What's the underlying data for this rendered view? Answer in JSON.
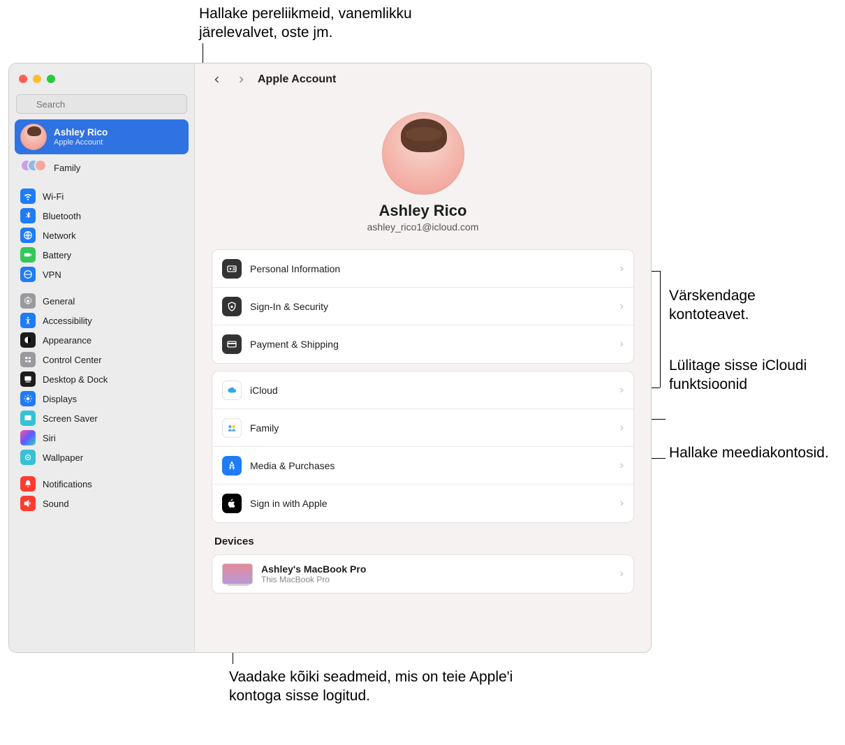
{
  "callouts": {
    "top": "Hallake pereliikmeid, vanemlikku järelevalvet, oste jm.",
    "right1": "Värskendage kontoteavet.",
    "right2": "Lülitage sisse iCloudi funktsioonid",
    "right3": "Hallake meediakontosid.",
    "bottom": "Vaadake kõiki seadmeid, mis on teie Apple'i kontoga sisse logitud."
  },
  "search": {
    "placeholder": "Search"
  },
  "account": {
    "name": "Ashley Rico",
    "role": "Apple Account"
  },
  "family": {
    "label": "Family"
  },
  "sidebar": {
    "group1": [
      {
        "label": "Wi-Fi"
      },
      {
        "label": "Bluetooth"
      },
      {
        "label": "Network"
      },
      {
        "label": "Battery"
      },
      {
        "label": "VPN"
      }
    ],
    "group2": [
      {
        "label": "General"
      },
      {
        "label": "Accessibility"
      },
      {
        "label": "Appearance"
      },
      {
        "label": "Control Center"
      },
      {
        "label": "Desktop & Dock"
      },
      {
        "label": "Displays"
      },
      {
        "label": "Screen Saver"
      },
      {
        "label": "Siri"
      },
      {
        "label": "Wallpaper"
      }
    ],
    "group3": [
      {
        "label": "Notifications"
      },
      {
        "label": "Sound"
      }
    ]
  },
  "header": {
    "title": "Apple Account"
  },
  "profile": {
    "name": "Ashley Rico",
    "email": "ashley_rico1@icloud.com"
  },
  "rows1": [
    {
      "label": "Personal Information"
    },
    {
      "label": "Sign-In & Security"
    },
    {
      "label": "Payment & Shipping"
    }
  ],
  "rows2": [
    {
      "label": "iCloud"
    },
    {
      "label": "Family"
    },
    {
      "label": "Media & Purchases"
    },
    {
      "label": "Sign in with Apple"
    }
  ],
  "devices": {
    "title": "Devices",
    "items": [
      {
        "name": "Ashley's MacBook Pro",
        "sub": "This MacBook Pro"
      }
    ]
  }
}
